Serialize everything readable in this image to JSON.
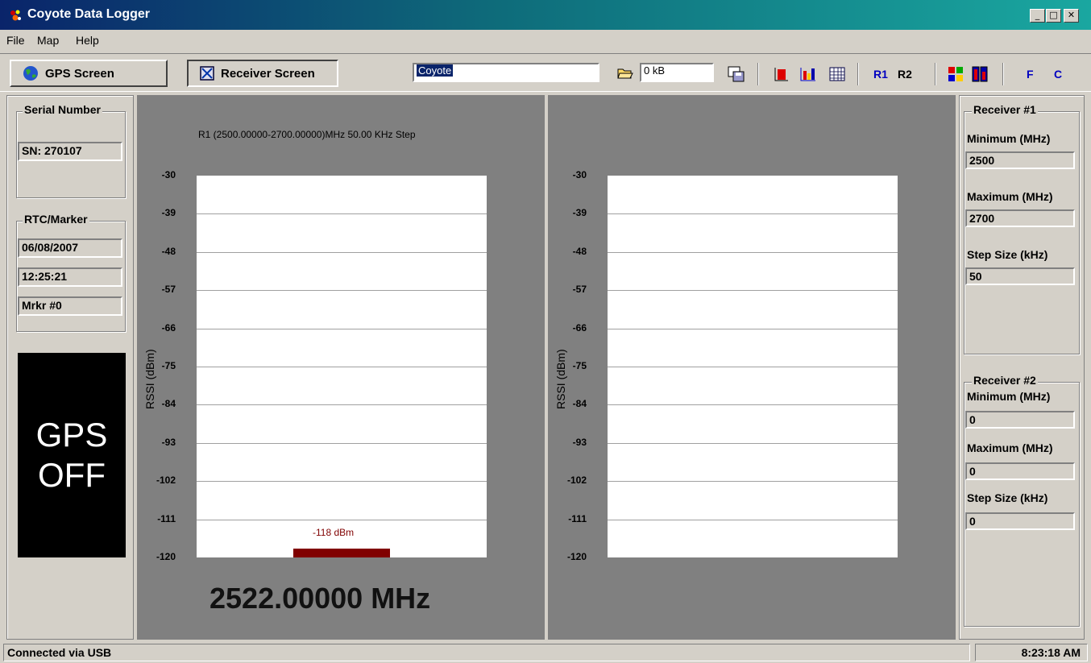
{
  "window": {
    "title": "Coyote Data Logger",
    "minimize": "_",
    "maximize": "□",
    "close": "✕"
  },
  "menu": {
    "file": "File",
    "map": "Map",
    "help": "Help"
  },
  "toolbar": {
    "gps_screen": "GPS Screen",
    "receiver_screen": "Receiver Screen",
    "name_value": "Coyote",
    "size_value": "0 kB",
    "r1": "R1",
    "r2": "R2",
    "f": "F",
    "c": "C"
  },
  "left": {
    "serial_legend": "Serial Number",
    "serial_value": "SN: 270107",
    "rtc_legend": "RTC/Marker",
    "date": "06/08/2007",
    "time": "12:25:21",
    "marker": "Mrkr #0",
    "gps_line1": "GPS",
    "gps_line2": "OFF"
  },
  "chart_data": [
    {
      "type": "bar",
      "title": "R1 (2500.00000-2700.00000)MHz 50.00 KHz Step",
      "ylabel": "RSSI (dBm)",
      "yticks": [
        "-30",
        "-39",
        "-48",
        "-57",
        "-66",
        "-75",
        "-84",
        "-93",
        "-102",
        "-111",
        "-120"
      ],
      "ylim": [
        -120,
        -30
      ],
      "values": [
        -118
      ],
      "value_label": "-118 dBm",
      "frequency": "2522.00000 MHz",
      "grid": true
    },
    {
      "type": "bar",
      "title": "",
      "ylabel": "RSSI (dBm)",
      "yticks": [
        "-30",
        "-39",
        "-48",
        "-57",
        "-66",
        "-75",
        "-84",
        "-93",
        "-102",
        "-111",
        "-120"
      ],
      "ylim": [
        -120,
        -30
      ],
      "values": [],
      "grid": true
    }
  ],
  "right": {
    "r1_legend": "Receiver #1",
    "r1_min_label": "Minimum (MHz)",
    "r1_min": "2500",
    "r1_max_label": "Maximum (MHz)",
    "r1_max": "2700",
    "r1_step_label": "Step Size (kHz)",
    "r1_step": "50",
    "r2_legend": "Receiver #2",
    "r2_min_label": "Minimum (MHz)",
    "r2_min": "0",
    "r2_max_label": "Maximum (MHz)",
    "r2_max": "0",
    "r2_step_label": "Step Size (kHz)",
    "r2_step": "0"
  },
  "status": {
    "connection": "Connected via USB",
    "clock": "8:23:18 AM"
  },
  "colors": {
    "bar": "#800000",
    "chart_bg": "#808080",
    "titlebar": "#0a246a"
  }
}
